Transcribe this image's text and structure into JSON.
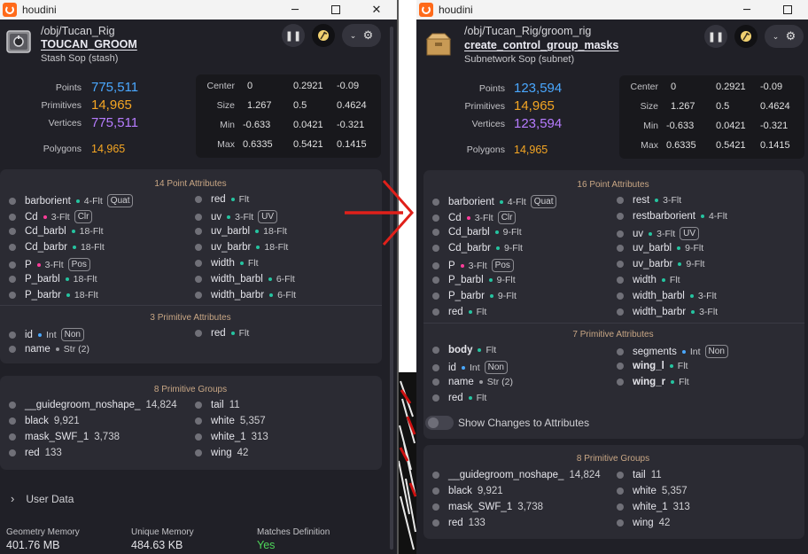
{
  "left": {
    "app_title": "houdini",
    "path": "/obj/Tucan_Rig",
    "node_name": "TOUCAN_GROOM",
    "node_type": "Stash Sop (stash)",
    "stats": [
      {
        "label": "Points",
        "value": "775,511"
      },
      {
        "label": "Primitives",
        "value": "14,965"
      },
      {
        "label": "Vertices",
        "value": "775,511"
      }
    ],
    "polygons": {
      "label": "Polygons",
      "value": "14,965"
    },
    "bbox": [
      {
        "label": "Center",
        "v": [
          "0",
          "0.2921",
          "-0.09"
        ]
      },
      {
        "label": "Size",
        "v": [
          "1.267",
          "0.5",
          "0.4624"
        ]
      },
      {
        "label": "Min",
        "v": [
          "-0.633",
          "0.0421",
          "-0.321"
        ]
      },
      {
        "label": "Max",
        "v": [
          "0.6335",
          "0.5421",
          "0.1415"
        ]
      }
    ],
    "point_attr_header": "14 Point Attributes",
    "point_attrs_left": [
      {
        "name": "barborient",
        "type": "4-Flt",
        "tag": "Quat"
      },
      {
        "name": "Cd",
        "type": "3-Flt",
        "tag": "Clr"
      },
      {
        "name": "Cd_barbl",
        "type": "18-Flt",
        "tag": ""
      },
      {
        "name": "Cd_barbr",
        "type": "18-Flt",
        "tag": ""
      },
      {
        "name": "P",
        "type": "3-Flt",
        "tag": "Pos"
      },
      {
        "name": "P_barbl",
        "type": "18-Flt",
        "tag": ""
      },
      {
        "name": "P_barbr",
        "type": "18-Flt",
        "tag": ""
      }
    ],
    "point_attrs_right": [
      {
        "name": "red",
        "type": "Flt",
        "tag": ""
      },
      {
        "name": "uv",
        "type": "3-Flt",
        "tag": "UV"
      },
      {
        "name": "uv_barbl",
        "type": "18-Flt",
        "tag": ""
      },
      {
        "name": "uv_barbr",
        "type": "18-Flt",
        "tag": ""
      },
      {
        "name": "width",
        "type": "Flt",
        "tag": ""
      },
      {
        "name": "width_barbl",
        "type": "6-Flt",
        "tag": ""
      },
      {
        "name": "width_barbr",
        "type": "6-Flt",
        "tag": ""
      }
    ],
    "prim_attr_header": "3 Primitive Attributes",
    "prim_attrs_left": [
      {
        "name": "id",
        "type": "Int",
        "tag": "Non"
      },
      {
        "name": "name",
        "type": "Str (2)",
        "tag": ""
      }
    ],
    "prim_attrs_right": [
      {
        "name": "red",
        "type": "Flt",
        "tag": ""
      }
    ],
    "group_header": "8 Primitive Groups",
    "groups_left": [
      {
        "name": "__guidegroom_noshape_",
        "count": "14,824"
      },
      {
        "name": "black",
        "count": "9,921"
      },
      {
        "name": "mask_SWF_1",
        "count": "3,738"
      },
      {
        "name": "red",
        "count": "133"
      }
    ],
    "groups_right": [
      {
        "name": "tail",
        "count": "11"
      },
      {
        "name": "white",
        "count": "5,357"
      },
      {
        "name": "white_1",
        "count": "313"
      },
      {
        "name": "wing",
        "count": "42"
      }
    ],
    "user_data_label": "User Data",
    "memory": [
      {
        "label": "Geometry Memory",
        "value": "401.76 MB"
      },
      {
        "label": "Unique Memory",
        "value": "484.63 KB"
      },
      {
        "label": "Matches Definition",
        "value": "Yes"
      }
    ]
  },
  "right": {
    "app_title": "houdini",
    "path": "/obj/Tucan_Rig/groom_rig",
    "node_name": "create_control_group_masks",
    "node_type": "Subnetwork Sop (subnet)",
    "stats": [
      {
        "label": "Points",
        "value": "123,594"
      },
      {
        "label": "Primitives",
        "value": "14,965"
      },
      {
        "label": "Vertices",
        "value": "123,594"
      }
    ],
    "polygons": {
      "label": "Polygons",
      "value": "14,965"
    },
    "bbox": [
      {
        "label": "Center",
        "v": [
          "0",
          "0.2921",
          "-0.09"
        ]
      },
      {
        "label": "Size",
        "v": [
          "1.267",
          "0.5",
          "0.4624"
        ]
      },
      {
        "label": "Min",
        "v": [
          "-0.633",
          "0.0421",
          "-0.321"
        ]
      },
      {
        "label": "Max",
        "v": [
          "0.6335",
          "0.5421",
          "0.1415"
        ]
      }
    ],
    "point_attr_header": "16 Point Attributes",
    "point_attrs_left": [
      {
        "name": "barborient",
        "type": "4-Flt",
        "tag": "Quat"
      },
      {
        "name": "Cd",
        "type": "3-Flt",
        "tag": "Clr"
      },
      {
        "name": "Cd_barbl",
        "type": "9-Flt",
        "tag": ""
      },
      {
        "name": "Cd_barbr",
        "type": "9-Flt",
        "tag": ""
      },
      {
        "name": "P",
        "type": "3-Flt",
        "tag": "Pos"
      },
      {
        "name": "P_barbl",
        "type": "9-Flt",
        "tag": ""
      },
      {
        "name": "P_barbr",
        "type": "9-Flt",
        "tag": ""
      },
      {
        "name": "red",
        "type": "Flt",
        "tag": ""
      }
    ],
    "point_attrs_right": [
      {
        "name": "rest",
        "type": "3-Flt",
        "tag": ""
      },
      {
        "name": "restbarborient",
        "type": "4-Flt",
        "tag": ""
      },
      {
        "name": "uv",
        "type": "3-Flt",
        "tag": "UV"
      },
      {
        "name": "uv_barbl",
        "type": "9-Flt",
        "tag": ""
      },
      {
        "name": "uv_barbr",
        "type": "9-Flt",
        "tag": ""
      },
      {
        "name": "width",
        "type": "Flt",
        "tag": ""
      },
      {
        "name": "width_barbl",
        "type": "3-Flt",
        "tag": ""
      },
      {
        "name": "width_barbr",
        "type": "3-Flt",
        "tag": ""
      }
    ],
    "prim_attr_header": "7 Primitive Attributes",
    "prim_attrs_left": [
      {
        "name": "body",
        "type": "Flt",
        "tag": ""
      },
      {
        "name": "id",
        "type": "Int",
        "tag": "Non"
      },
      {
        "name": "name",
        "type": "Str (2)",
        "tag": ""
      },
      {
        "name": "red",
        "type": "Flt",
        "tag": ""
      }
    ],
    "prim_attrs_right": [
      {
        "name": "segments",
        "type": "Int",
        "tag": "Non"
      },
      {
        "name": "wing_l",
        "type": "Flt",
        "tag": ""
      },
      {
        "name": "wing_r",
        "type": "Flt",
        "tag": ""
      }
    ],
    "show_changes_label": "Show Changes to Attributes",
    "group_header": "8 Primitive Groups",
    "groups_left": [
      {
        "name": "__guidegroom_noshape_",
        "count": "14,824"
      },
      {
        "name": "black",
        "count": "9,921"
      },
      {
        "name": "mask_SWF_1",
        "count": "3,738"
      },
      {
        "name": "red",
        "count": "133"
      }
    ],
    "groups_right": [
      {
        "name": "tail",
        "count": "11"
      },
      {
        "name": "white",
        "count": "5,357"
      },
      {
        "name": "white_1",
        "count": "313"
      },
      {
        "name": "wing",
        "count": "42"
      }
    ]
  },
  "colors": {
    "points": "#4aa8ff",
    "primitives": "#f5a623",
    "vertices": "#b77cff",
    "int_dot": "#4aa8ff",
    "flt_dot": "#25c4a0",
    "str_dot": "#9a9aa0",
    "clr_dot": "#ff3d9a",
    "pos_dot": "#ff3d9a",
    "yes": "#4ed65a",
    "arrow": "#e0201a"
  },
  "icons": [
    "houdini-logo-icon",
    "stash-node-icon",
    "subnet-node-icon",
    "pause-icon",
    "flag-icon",
    "chevron-down-icon",
    "gear-icon",
    "chevron-right-icon",
    "minimize-icon",
    "maximize-icon",
    "close-icon",
    "arrow-icon"
  ]
}
